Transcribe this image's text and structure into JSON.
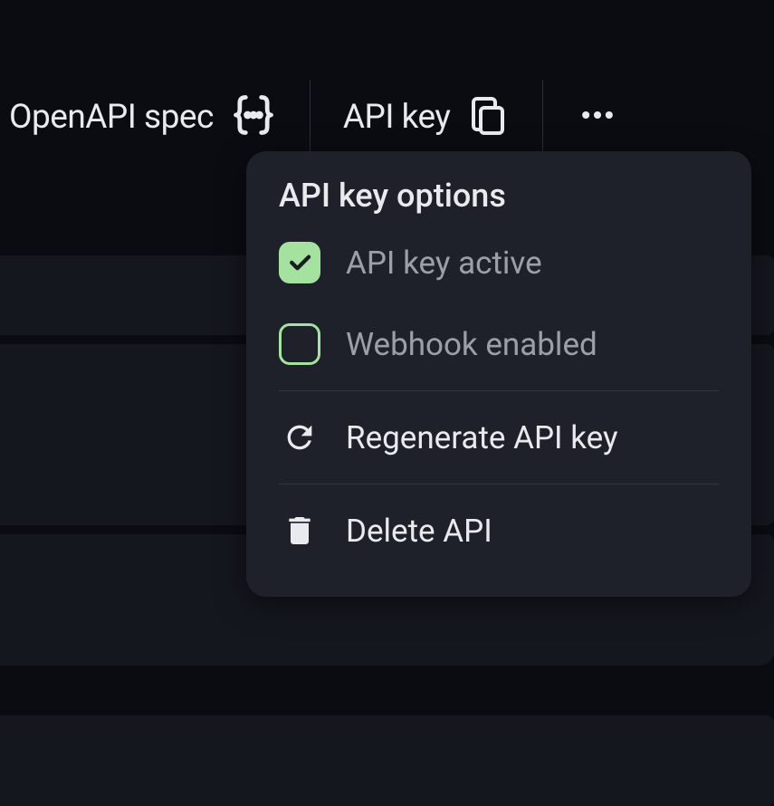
{
  "toolbar": {
    "openapi_label": "OpenAPI spec",
    "apikey_label": "API key"
  },
  "popover": {
    "title": "API key options",
    "items": {
      "active": "API key active",
      "webhook": "Webhook enabled",
      "regenerate": "Regenerate API key",
      "delete": "Delete API"
    }
  }
}
